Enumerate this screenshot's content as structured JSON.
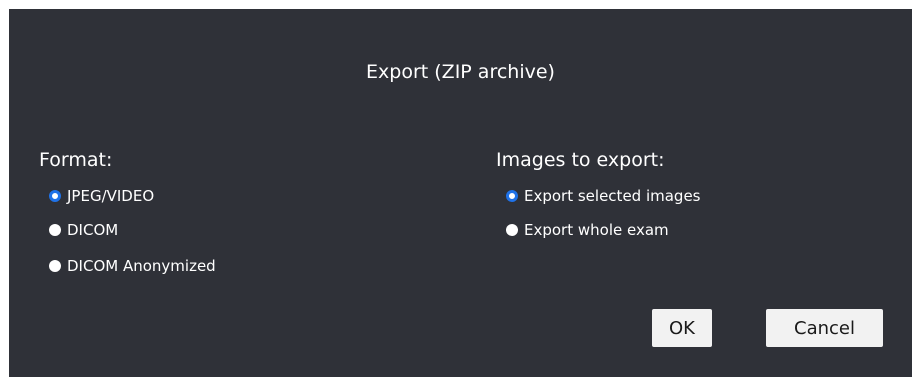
{
  "dialog": {
    "title": "Export (ZIP archive)",
    "format": {
      "label": "Format:",
      "options": [
        {
          "label": "JPEG/VIDEO",
          "checked": true
        },
        {
          "label": "DICOM",
          "checked": false
        },
        {
          "label": "DICOM Anonymized",
          "checked": false
        }
      ]
    },
    "images": {
      "label": "Images to export:",
      "options": [
        {
          "label": "Export selected images",
          "checked": true
        },
        {
          "label": "Export whole exam",
          "checked": false
        }
      ]
    },
    "buttons": {
      "ok": "OK",
      "cancel": "Cancel"
    }
  },
  "colors": {
    "background": "#2f3138",
    "radio_accent": "#1f72e8",
    "button_bg": "#f2f2f2"
  }
}
